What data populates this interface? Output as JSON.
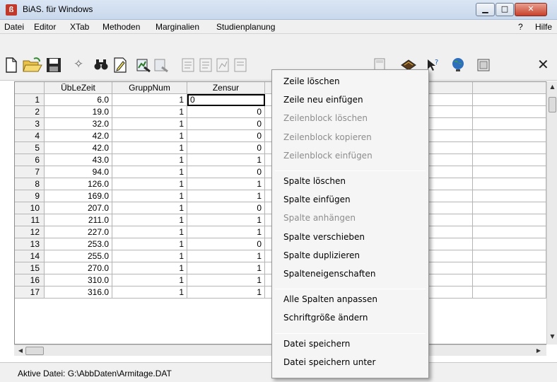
{
  "window": {
    "title": "BiAS. für Windows",
    "icon_glyph": "ß",
    "min_glyph": "▁",
    "max_glyph": "□",
    "close_glyph": "✕"
  },
  "menubar": {
    "items": [
      "Datei",
      "Editor",
      "XTab",
      "Methoden",
      "Marginalien",
      "Studienplanung"
    ],
    "help_q": "?",
    "help": "Hilfe"
  },
  "toolbar": {
    "icons": [
      "new-file-icon",
      "open-folder-icon",
      "save-icon",
      "magic-wand-icon",
      "binoculars-icon",
      "edit-icon",
      "chart-table-icon",
      "chart-table-2-icon",
      "document-1-icon",
      "document-2-icon",
      "document-3-icon",
      "document-4-icon",
      "calculator-icon",
      "book-icon",
      "help-pointer-icon",
      "globe-icon",
      "window-icon",
      "close-x-icon"
    ]
  },
  "grid": {
    "columns": [
      "",
      "ÜbLeZeit",
      "GruppNum",
      "Zensur",
      "",
      "",
      "",
      ""
    ],
    "rows": [
      [
        "1",
        "6.0",
        "1",
        "0"
      ],
      [
        "2",
        "19.0",
        "1",
        "0"
      ],
      [
        "3",
        "32.0",
        "1",
        "0"
      ],
      [
        "4",
        "42.0",
        "1",
        "0"
      ],
      [
        "5",
        "42.0",
        "1",
        "0"
      ],
      [
        "6",
        "43.0",
        "1",
        "1"
      ],
      [
        "7",
        "94.0",
        "1",
        "0"
      ],
      [
        "8",
        "126.0",
        "1",
        "1"
      ],
      [
        "9",
        "169.0",
        "1",
        "1"
      ],
      [
        "10",
        "207.0",
        "1",
        "0"
      ],
      [
        "11",
        "211.0",
        "1",
        "1"
      ],
      [
        "12",
        "227.0",
        "1",
        "1"
      ],
      [
        "13",
        "253.0",
        "1",
        "0"
      ],
      [
        "14",
        "255.0",
        "1",
        "1"
      ],
      [
        "15",
        "270.0",
        "1",
        "1"
      ],
      [
        "16",
        "310.0",
        "1",
        "1"
      ],
      [
        "17",
        "316.0",
        "1",
        "1"
      ]
    ]
  },
  "context_menu": {
    "groups": [
      [
        {
          "label": "Zeile löschen",
          "enabled": true
        },
        {
          "label": "Zeile neu einfügen",
          "enabled": true
        },
        {
          "label": "Zeilenblock löschen",
          "enabled": false
        },
        {
          "label": "Zeilenblock kopieren",
          "enabled": false
        },
        {
          "label": "Zeilenblock einfügen",
          "enabled": false
        }
      ],
      [
        {
          "label": "Spalte löschen",
          "enabled": true
        },
        {
          "label": "Spalte einfügen",
          "enabled": true
        },
        {
          "label": "Spalte anhängen",
          "enabled": false
        },
        {
          "label": "Spalte verschieben",
          "enabled": true
        },
        {
          "label": "Spalte duplizieren",
          "enabled": true
        },
        {
          "label": "Spalteneigenschaften",
          "enabled": true
        }
      ],
      [
        {
          "label": "Alle Spalten anpassen",
          "enabled": true
        },
        {
          "label": "Schriftgröße ändern",
          "enabled": true
        }
      ],
      [
        {
          "label": "Datei speichern",
          "enabled": true
        },
        {
          "label": "Datei speichern unter",
          "enabled": true
        }
      ]
    ]
  },
  "statusbar": {
    "text": "Aktive Datei: G:\\AbbDaten\\Armitage.DAT"
  }
}
